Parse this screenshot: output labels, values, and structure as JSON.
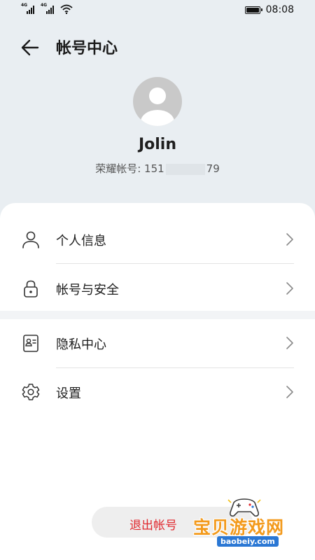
{
  "status_bar": {
    "signal_1_tag": "4G",
    "signal_2_tag": "4G",
    "icons": [
      "signal-4g-icon",
      "signal-4g-icon",
      "wifi-icon",
      "battery-icon"
    ],
    "time": "08:08"
  },
  "header": {
    "back_icon": "back-arrow-icon",
    "title": "帐号中心"
  },
  "profile": {
    "avatar_icon": "default-avatar-icon",
    "name": "Jolin",
    "account_prefix": "荣耀帐号: 151",
    "account_suffix": "79"
  },
  "menu": {
    "groups": [
      [
        {
          "icon": "person-icon",
          "label": "个人信息"
        },
        {
          "icon": "lock-icon",
          "label": "帐号与安全"
        }
      ],
      [
        {
          "icon": "privacy-card-icon",
          "label": "隐私中心"
        },
        {
          "icon": "gear-icon",
          "label": "设置"
        }
      ]
    ],
    "chevron_icon": "chevron-right-icon"
  },
  "logout": {
    "label": "退出帐号"
  },
  "watermark": {
    "text": "宝贝游戏网",
    "url": "baobeiy.com"
  },
  "colors": {
    "background": "#e9eef2",
    "card": "#ffffff",
    "logout_text": "#e0282e",
    "watermark_orange": "#f39a1c",
    "watermark_blue": "#2a77d4"
  }
}
